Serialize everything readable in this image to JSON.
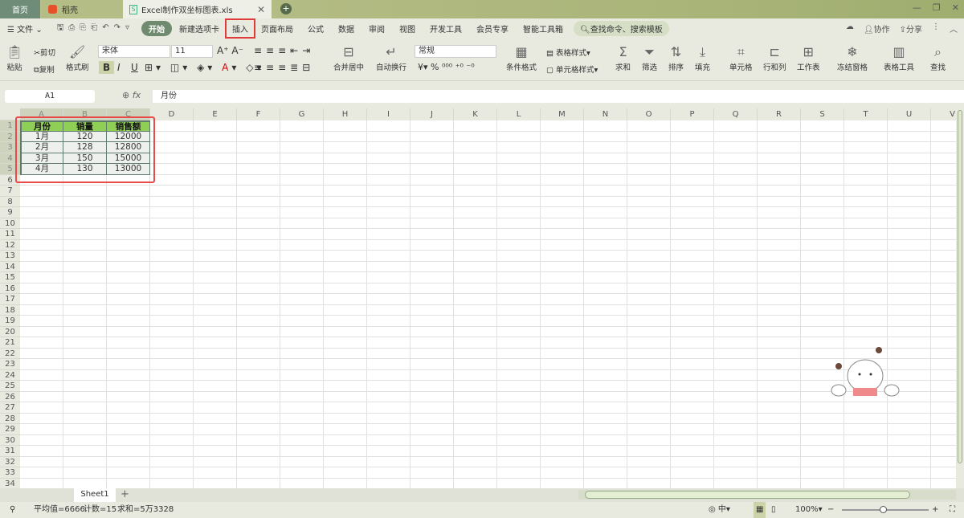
{
  "tabs": {
    "home": "首页",
    "wps": "稻壳",
    "doc": "Excel制作双坐标图表.xls",
    "close": "✕",
    "new": "+"
  },
  "window": {
    "min": "—",
    "restore": "❐",
    "close": "✕"
  },
  "menu": {
    "file": "文件",
    "items": [
      "开始",
      "新建选项卡",
      "插入",
      "页面布局",
      "公式",
      "数据",
      "审阅",
      "视图",
      "开发工具",
      "会员专享",
      "智能工具箱"
    ],
    "search": "查找命令、搜索模板",
    "collab": "协作",
    "share": "分享"
  },
  "ribbon": {
    "paste": "粘贴",
    "cut": "剪切",
    "copy": "复制",
    "format_painter": "格式刷",
    "font": "宋体",
    "size": "11",
    "bold": "B",
    "italic": "I",
    "underline": "U",
    "merge": "合并居中",
    "wrap": "自动换行",
    "numfmt": "常规",
    "currency": "¥",
    "percent": "%",
    "cond_format": "条件格式",
    "table_style": "表格样式",
    "cell_style": "单元格样式",
    "sum": "求和",
    "filter": "筛选",
    "sort": "排序",
    "fill": "填充",
    "cell": "单元格",
    "rowcol": "行和列",
    "worksheet": "工作表",
    "freeze": "冻结窗格",
    "table_tools": "表格工具",
    "find": "查找"
  },
  "formula_bar": {
    "name_box": "A1",
    "fx": "fx",
    "value": "月份"
  },
  "columns": [
    "A",
    "B",
    "C",
    "D",
    "E",
    "F",
    "G",
    "H",
    "I",
    "J",
    "K",
    "L",
    "M",
    "N",
    "O",
    "P",
    "Q",
    "R",
    "S",
    "T",
    "U",
    "V"
  ],
  "table": {
    "headers": [
      "月份",
      "销量",
      "销售额"
    ],
    "rows": [
      [
        "1月",
        "120",
        "12000"
      ],
      [
        "2月",
        "128",
        "12800"
      ],
      [
        "3月",
        "150",
        "15000"
      ],
      [
        "4月",
        "130",
        "13000"
      ]
    ]
  },
  "sheet_tab": "Sheet1",
  "status": {
    "average": "平均值=6666",
    "count": "计数=15",
    "sum": "求和=5万3328",
    "zoom": "100%"
  },
  "colors": {
    "header_green": "#8fcf55",
    "highlight_red": "#e84a4a",
    "active_tab": "#6f8a6e"
  }
}
